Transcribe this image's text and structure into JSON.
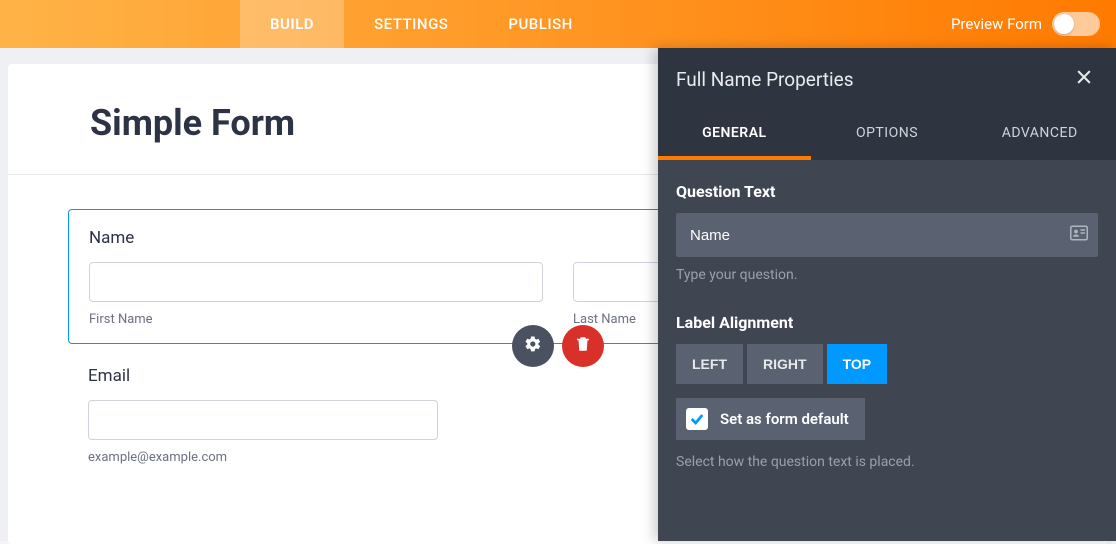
{
  "topnav": {
    "tabs": [
      {
        "label": "BUILD",
        "active": true
      },
      {
        "label": "SETTINGS",
        "active": false
      },
      {
        "label": "PUBLISH",
        "active": false
      }
    ],
    "preview_label": "Preview Form"
  },
  "form": {
    "title": "Simple Form",
    "name_field": {
      "label": "Name",
      "first_sublabel": "First Name",
      "last_sublabel": "Last Name"
    },
    "email_field": {
      "label": "Email",
      "placeholder": "example@example.com"
    }
  },
  "panel": {
    "title": "Full Name Properties",
    "tabs": [
      {
        "label": "GENERAL",
        "active": true
      },
      {
        "label": "OPTIONS",
        "active": false
      },
      {
        "label": "ADVANCED",
        "active": false
      }
    ],
    "question": {
      "section_label": "Question Text",
      "value": "Name",
      "help": "Type your question."
    },
    "alignment": {
      "section_label": "Label Alignment",
      "options": [
        {
          "label": "LEFT",
          "active": false
        },
        {
          "label": "RIGHT",
          "active": false
        },
        {
          "label": "TOP",
          "active": true
        }
      ],
      "default_label": "Set as form default",
      "default_checked": true,
      "help": "Select how the question text is placed."
    }
  }
}
